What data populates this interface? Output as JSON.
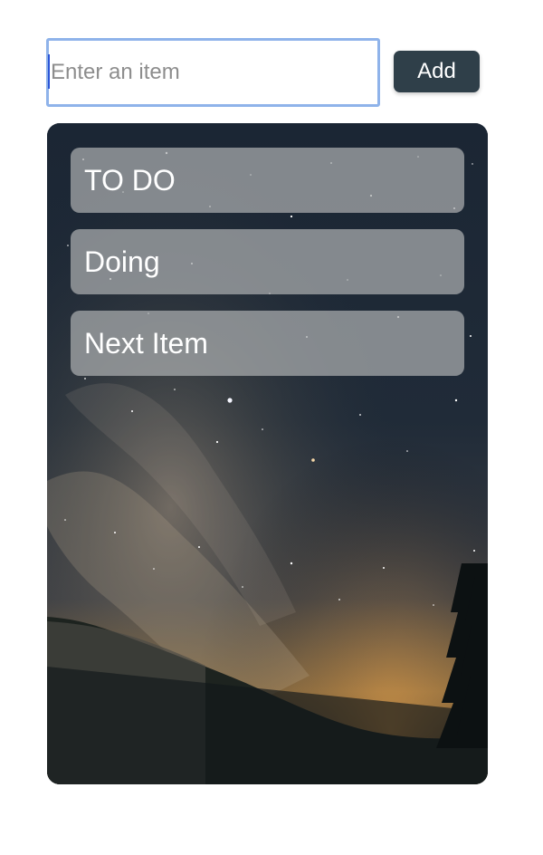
{
  "form": {
    "input_value": "",
    "input_placeholder": "Enter an item",
    "add_button_label": "Add"
  },
  "list": {
    "items": [
      {
        "label": "TO DO"
      },
      {
        "label": "Doing"
      },
      {
        "label": "Next Item"
      }
    ]
  },
  "colors": {
    "button_bg": "#2f3f49",
    "input_border": "#8fb3ea",
    "card_bg": "rgba(172,174,176,0.72)"
  }
}
